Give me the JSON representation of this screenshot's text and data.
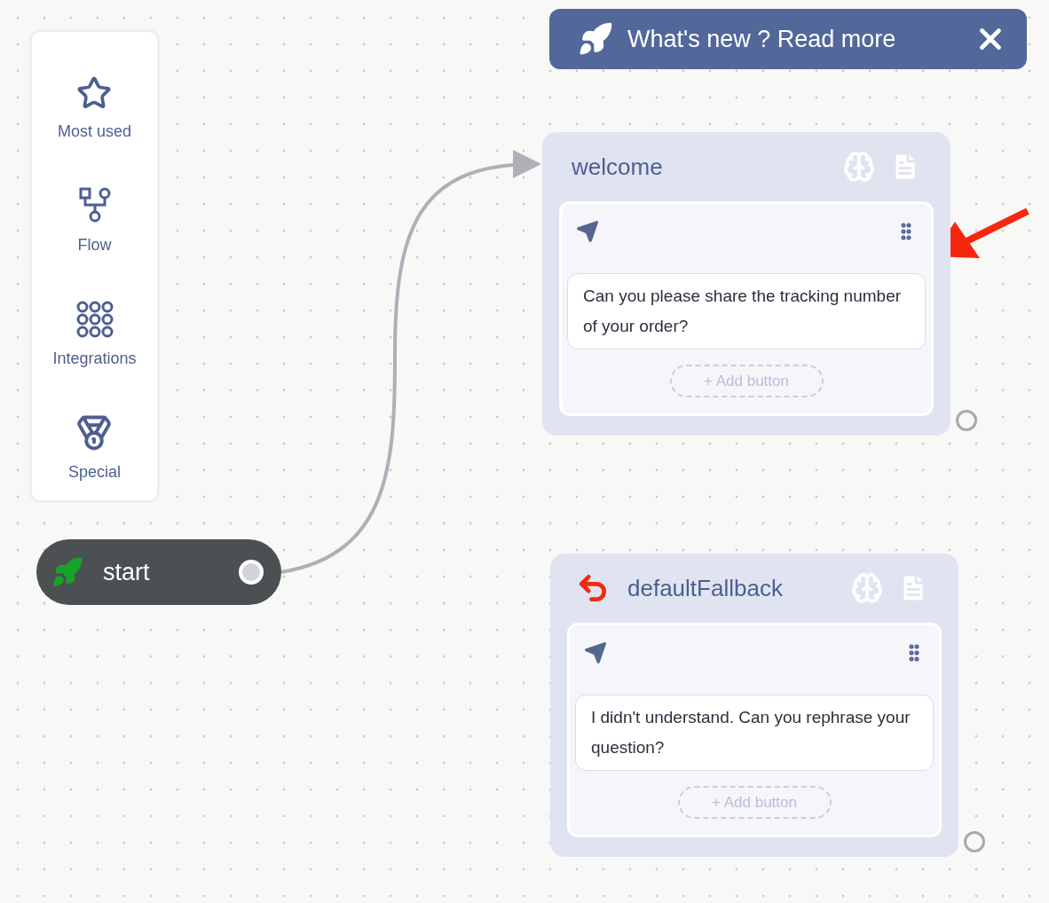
{
  "sidebar": {
    "items": [
      {
        "label": "Most used",
        "kind": "star"
      },
      {
        "label": "Flow",
        "kind": "flow"
      },
      {
        "label": "Integrations",
        "kind": "grid"
      },
      {
        "label": "Special",
        "kind": "medal"
      }
    ]
  },
  "banner": {
    "text": "What's new ? Read more"
  },
  "start_node": {
    "label": "start"
  },
  "nodes": [
    {
      "kind": "intent",
      "title": "welcome",
      "message": "Can you please share the tracking number of your order?",
      "add_button": "+ Add button"
    },
    {
      "kind": "fallback",
      "title": "defaultFallback",
      "message": "I didn't understand. Can you rephrase your question?",
      "add_button": "+ Add button"
    }
  ]
}
